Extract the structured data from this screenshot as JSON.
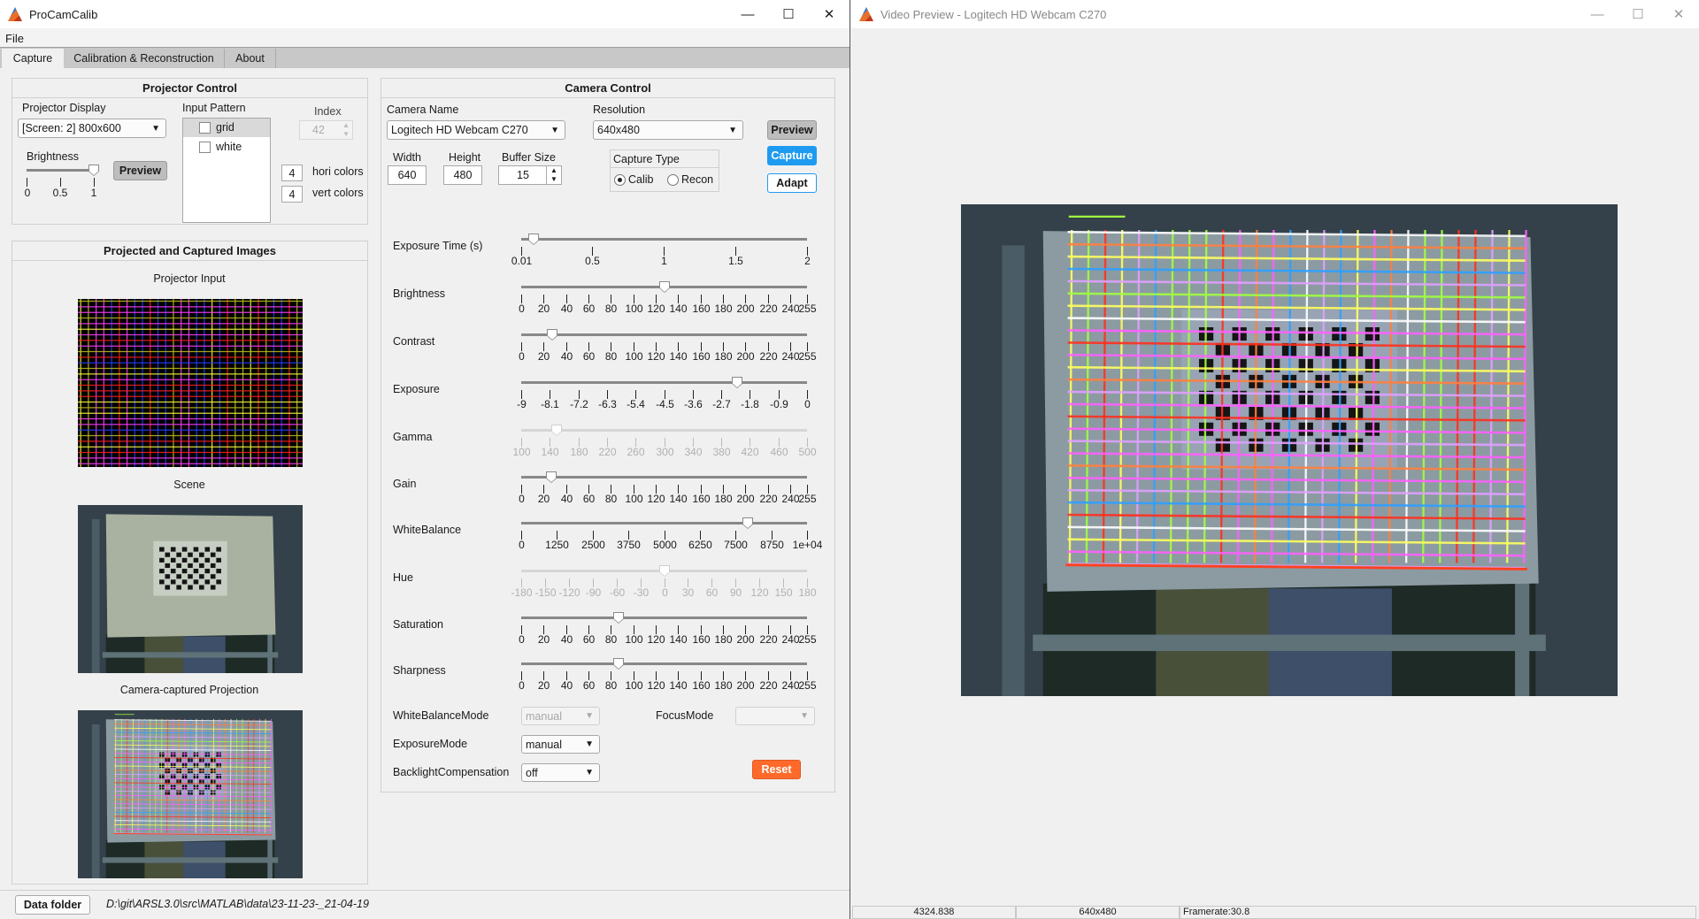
{
  "main_window": {
    "title": "ProCamCalib",
    "menu": [
      "File"
    ],
    "window_controls": [
      "minimize-icon",
      "maximize-icon",
      "close-icon"
    ],
    "tabs": [
      {
        "label": "Capture",
        "active": true
      },
      {
        "label": "Calibration & Reconstruction",
        "active": false
      },
      {
        "label": "About",
        "active": false
      }
    ],
    "projector_control": {
      "title": "Projector Control",
      "display_label": "Projector Display",
      "display_value": "[Screen: 2] 800x600",
      "brightness_label": "Brightness",
      "brightness": {
        "value": 1,
        "min": 0,
        "max": 1,
        "ticks": [
          "0",
          "0.5",
          "1"
        ]
      },
      "preview_label": "Preview",
      "input_pattern_label": "Input Pattern",
      "patterns": [
        {
          "label": "grid",
          "selected": true,
          "checked": false
        },
        {
          "label": "white",
          "selected": false,
          "checked": false
        }
      ],
      "index_label": "Index",
      "index_value": "42",
      "hori_colors_value": "4",
      "hori_colors_label": "hori colors",
      "vert_colors_value": "4",
      "vert_colors_label": "vert colors"
    },
    "images_panel": {
      "title": "Projected and Captured Images",
      "projector_input_label": "Projector Input",
      "scene_label": "Scene",
      "captured_label": "Camera-captured Projection"
    },
    "camera_control": {
      "title": "Camera Control",
      "camera_name_label": "Camera Name",
      "camera_name_value": "Logitech HD Webcam C270",
      "resolution_label": "Resolution",
      "resolution_value": "640x480",
      "preview_label": "Preview",
      "capture_label": "Capture",
      "adapt_label": "Adapt",
      "width_label": "Width",
      "width_value": "640",
      "height_label": "Height",
      "height_value": "480",
      "buffer_label": "Buffer Size",
      "buffer_value": "15",
      "capture_type_label": "Capture Type",
      "capture_types": [
        {
          "label": "Calib",
          "selected": true
        },
        {
          "label": "Recon",
          "selected": false
        }
      ],
      "sliders": [
        {
          "label": "Exposure Time (s)",
          "min": 0.01,
          "max": 2,
          "value": 0.095,
          "enabled": true,
          "ticks": [
            0.01,
            0.5,
            1,
            1.5,
            2
          ],
          "tick_labels": [
            "0.01",
            "0.5",
            "1",
            "1.5",
            "2"
          ]
        },
        {
          "label": "Brightness",
          "min": 0,
          "max": 255,
          "value": 128,
          "enabled": true,
          "ticks": [
            0,
            20,
            40,
            60,
            80,
            100,
            120,
            140,
            160,
            180,
            200,
            220,
            240,
            255
          ],
          "tick_labels": [
            "0",
            "20",
            "40",
            "60",
            "80",
            "100",
            "120",
            "140",
            "160",
            "180",
            "200",
            "220",
            "240",
            "255"
          ]
        },
        {
          "label": "Contrast",
          "min": 0,
          "max": 255,
          "value": 28,
          "enabled": true,
          "ticks": [
            0,
            20,
            40,
            60,
            80,
            100,
            120,
            140,
            160,
            180,
            200,
            220,
            240,
            255
          ],
          "tick_labels": [
            "0",
            "20",
            "40",
            "60",
            "80",
            "100",
            "120",
            "140",
            "160",
            "180",
            "200",
            "220",
            "240",
            "255"
          ]
        },
        {
          "label": "Exposure",
          "min": -9,
          "max": 0,
          "value": -2.2,
          "enabled": true,
          "ticks": [
            -9,
            -8.1,
            -7.2,
            -6.3,
            -5.4,
            -4.5,
            -3.6,
            -2.7,
            -1.8,
            -0.9,
            0
          ],
          "tick_labels": [
            "-9",
            "-8.1",
            "-7.2",
            "-6.3",
            "-5.4",
            "-4.5",
            "-3.6",
            "-2.7",
            "-1.8",
            "-0.9",
            "0"
          ]
        },
        {
          "label": "Gamma",
          "min": 100,
          "max": 500,
          "value": 150,
          "enabled": false,
          "ticks": [
            100,
            140,
            180,
            220,
            260,
            300,
            340,
            380,
            420,
            460,
            500
          ],
          "tick_labels": [
            "100",
            "140",
            "180",
            "220",
            "260",
            "300",
            "340",
            "380",
            "420",
            "460",
            "500"
          ]
        },
        {
          "label": "Gain",
          "min": 0,
          "max": 255,
          "value": 27,
          "enabled": true,
          "ticks": [
            0,
            20,
            40,
            60,
            80,
            100,
            120,
            140,
            160,
            180,
            200,
            220,
            240,
            255
          ],
          "tick_labels": [
            "0",
            "20",
            "40",
            "60",
            "80",
            "100",
            "120",
            "140",
            "160",
            "180",
            "200",
            "220",
            "240",
            "255"
          ]
        },
        {
          "label": "WhiteBalance",
          "min": 0,
          "max": 10000,
          "value": 7930,
          "enabled": true,
          "ticks": [
            0,
            1250,
            2500,
            3750,
            5000,
            6250,
            7500,
            8750,
            10000
          ],
          "tick_labels": [
            "0",
            "1250",
            "2500",
            "3750",
            "5000",
            "6250",
            "7500",
            "8750",
            "1e+04"
          ]
        },
        {
          "label": "Hue",
          "min": -180,
          "max": 180,
          "value": 0,
          "enabled": false,
          "ticks": [
            -180,
            -150,
            -120,
            -90,
            -60,
            -30,
            0,
            30,
            60,
            90,
            120,
            150,
            180
          ],
          "tick_labels": [
            "-180",
            "-150",
            "-120",
            "-90",
            "-60",
            "-30",
            "0",
            "30",
            "60",
            "90",
            "120",
            "150",
            "180"
          ]
        },
        {
          "label": "Saturation",
          "min": 0,
          "max": 255,
          "value": 87,
          "enabled": true,
          "ticks": [
            0,
            20,
            40,
            60,
            80,
            100,
            120,
            140,
            160,
            180,
            200,
            220,
            240,
            255
          ],
          "tick_labels": [
            "0",
            "20",
            "40",
            "60",
            "80",
            "100",
            "120",
            "140",
            "160",
            "180",
            "200",
            "220",
            "240",
            "255"
          ]
        },
        {
          "label": "Sharpness",
          "min": 0,
          "max": 255,
          "value": 87,
          "enabled": true,
          "ticks": [
            0,
            20,
            40,
            60,
            80,
            100,
            120,
            140,
            160,
            180,
            200,
            220,
            240,
            255
          ],
          "tick_labels": [
            "0",
            "20",
            "40",
            "60",
            "80",
            "100",
            "120",
            "140",
            "160",
            "180",
            "200",
            "220",
            "240",
            "255"
          ]
        }
      ],
      "wb_mode_label": "WhiteBalanceMode",
      "wb_mode_value": "manual",
      "focus_mode_label": "FocusMode",
      "focus_mode_value": "",
      "exposure_mode_label": "ExposureMode",
      "exposure_mode_value": "manual",
      "backlight_label": "BacklightCompensation",
      "backlight_value": "off",
      "reset_label": "Reset"
    },
    "data_folder_label": "Data folder",
    "data_folder_path": "D:\\git\\ARSL3.0\\src\\MATLAB\\data\\23-11-23-_21-04-19"
  },
  "preview_window": {
    "title": "Video Preview - Logitech HD Webcam C270",
    "status": [
      "4324.838",
      "640x480",
      "Framerate:30.8"
    ]
  },
  "colors": {
    "capture_button": "#1e9bf0",
    "reset_button": "#ff6a2b",
    "tab_bar": "#c8c8c8",
    "grid_line_colors": [
      "#ffff40",
      "#ff40ff",
      "#ff2020",
      "#2040ff",
      "#c0c020"
    ]
  }
}
